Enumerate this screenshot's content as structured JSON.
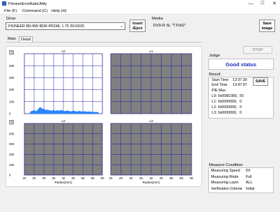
{
  "window": {
    "title": "PioneerErrorRateUtility",
    "minimize": "—",
    "maximize": "☐",
    "close": "✕"
  },
  "menu": {
    "file": "File (F)",
    "command": "Command (C)",
    "help": "Help (H)"
  },
  "drive": {
    "label": "Drive",
    "selected": "PIONEER BD-RW BDR-PR1ML 1.75 20/10/26",
    "eject_label_line1": "Insert",
    "eject_label_line2": "/Eject"
  },
  "media": {
    "label": "Media",
    "value": "DVD-R SL \"TTH02\""
  },
  "save_image": {
    "line1": "Save",
    "line2": "Image"
  },
  "tabs": [
    {
      "label": "Main"
    },
    {
      "label": "Detail"
    }
  ],
  "charts": {
    "ylabel": "PIE",
    "xlabel": "Radius(mm)",
    "panels": [
      "L0",
      "L1",
      "L2",
      "L3"
    ]
  },
  "chart_data": [
    {
      "type": "area",
      "title": "L0",
      "ylabel": "PIE",
      "xlabel": "Radius(mm)",
      "ylim": [
        0,
        500
      ],
      "xlim": [
        20,
        60
      ],
      "yticks": [
        0,
        100,
        200,
        300,
        400,
        500
      ],
      "xticks": [
        20,
        25,
        30,
        35,
        40,
        45,
        50,
        55,
        60
      ],
      "grid": true,
      "color": "#1e80ff",
      "x": [
        23,
        24,
        25,
        26,
        27,
        28,
        29,
        30,
        31,
        32,
        33,
        34,
        35,
        36,
        37,
        38,
        39,
        40,
        41,
        42,
        43,
        44,
        45,
        46,
        47,
        48,
        49,
        50,
        51,
        52,
        53,
        54,
        55,
        56,
        57,
        58
      ],
      "y": [
        16,
        22,
        28,
        20,
        34,
        55,
        42,
        38,
        30,
        32,
        26,
        24,
        30,
        22,
        28,
        24,
        30,
        22,
        20,
        26,
        20,
        18,
        24,
        20,
        16,
        22,
        18,
        16,
        20,
        14,
        18,
        14,
        16,
        12,
        14,
        10
      ]
    },
    {
      "type": "area",
      "title": "L1",
      "ylim": [
        0,
        500
      ],
      "xlim": [
        20,
        60
      ],
      "grid": true,
      "values": [],
      "background": "#808080"
    },
    {
      "type": "area",
      "title": "L2",
      "ylim": [
        0,
        500
      ],
      "xlim": [
        20,
        60
      ],
      "grid": true,
      "values": [],
      "background": "#808080"
    },
    {
      "type": "area",
      "title": "L3",
      "ylim": [
        0,
        500
      ],
      "xlim": [
        20,
        60
      ],
      "grid": true,
      "values": [],
      "background": "#808080"
    }
  ],
  "stop_button": "STOP",
  "judge": {
    "label": "Judge",
    "status": "Good status"
  },
  "result": {
    "label": "Result",
    "start_label": "Start Time",
    "start_value": "13:37:39",
    "end_label": "End Time",
    "end_value": "13:47:07",
    "save_label": "SAVE",
    "pie_max_label": "PIE Max",
    "rows": [
      {
        "addr": "L0: 0x008D380,",
        "value": "55"
      },
      {
        "addr": "L1: 0x0000000,",
        "value": "0"
      },
      {
        "addr": "L2: 0x0000000,",
        "value": "0"
      },
      {
        "addr": "L3: 0x0000000,",
        "value": "0"
      }
    ]
  },
  "measure": {
    "label": "Measure Condition",
    "rows": [
      {
        "key": "Measuring Speed",
        "value": "6X"
      },
      {
        "key": "Measuring Mode",
        "value": "Full"
      },
      {
        "key": "Measuring Layer",
        "value": "ALL"
      },
      {
        "key": "Verification Criteria",
        "value": "Initial"
      }
    ]
  }
}
